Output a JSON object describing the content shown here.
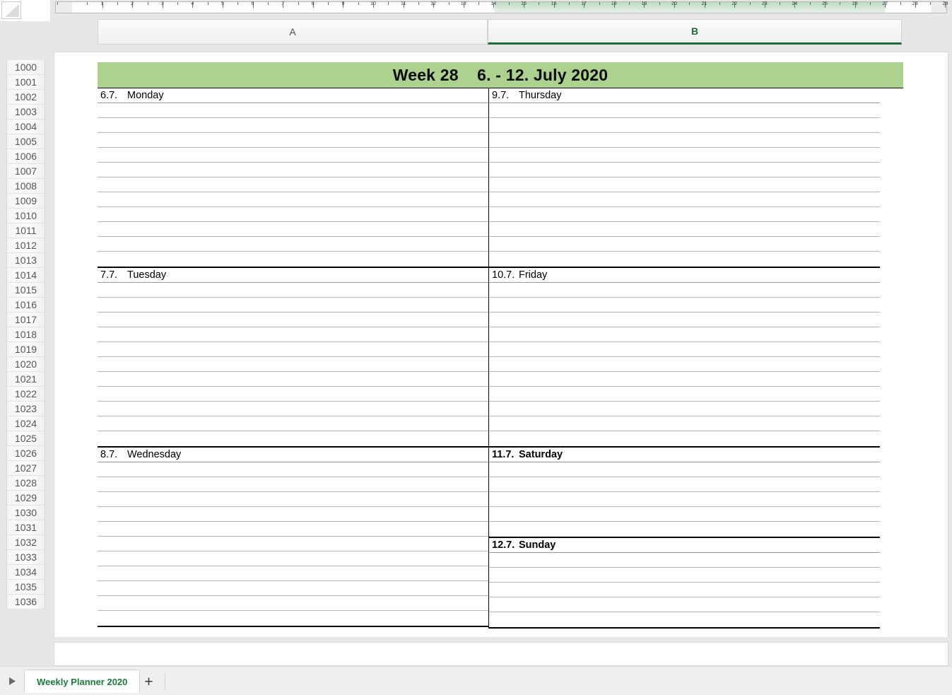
{
  "app": {
    "type": "spreadsheet",
    "select_all_icon": "select-all-triangle-icon"
  },
  "ruler": {
    "unit_labels": [
      "1",
      "2",
      "3",
      "4",
      "5",
      "6",
      "7",
      "8",
      "9",
      "10",
      "11",
      "12",
      "13",
      "14",
      "15",
      "16",
      "17",
      "18",
      "19",
      "20",
      "21",
      "22",
      "23",
      "24",
      "25",
      "26",
      "27",
      "28",
      "29"
    ],
    "selected_range_start": 14,
    "selected_range_end": 27.5
  },
  "columns": {
    "headers": [
      {
        "label": "A",
        "selected": false
      },
      {
        "label": "B",
        "selected": true
      }
    ],
    "selection_accent": "#1f6b3b"
  },
  "rows": {
    "first": 1000,
    "last": 1036
  },
  "planner": {
    "title": "Week 28    6. - 12. July 2020",
    "header_bg": "#add18f",
    "left_column": [
      {
        "date": "6.7.",
        "day": "Monday",
        "weekend": false,
        "rows": [
          "1001"
        ],
        "lines": 11
      },
      {
        "date": "7.7.",
        "day": "Tuesday",
        "weekend": false,
        "rows": [
          "1013"
        ],
        "lines": 11
      },
      {
        "date": "8.7.",
        "day": "Wednesday",
        "weekend": false,
        "rows": [
          "1025"
        ],
        "lines": 11
      }
    ],
    "right_column": [
      {
        "date": "9.7.",
        "day": "Thursday",
        "weekend": false,
        "rows": [
          "1001"
        ],
        "lines": 11
      },
      {
        "date": "10.7.",
        "day": "Friday",
        "weekend": false,
        "rows": [
          "1013"
        ],
        "lines": 11
      },
      {
        "date": "11.7.",
        "day": "Saturday",
        "weekend": true,
        "rows": [
          "1025"
        ],
        "lines": 5
      },
      {
        "date": "12.7.",
        "day": "Sunday",
        "weekend": true,
        "rows": [
          "1031"
        ],
        "lines": 5
      }
    ]
  },
  "tabbar": {
    "nav_arrow_icon": "play-arrow-icon",
    "sheets": [
      {
        "name": "Weekly Planner 2020",
        "active": true
      }
    ],
    "add_sheet_label": "+",
    "sheet_tab_color": "#1d7a3e"
  }
}
